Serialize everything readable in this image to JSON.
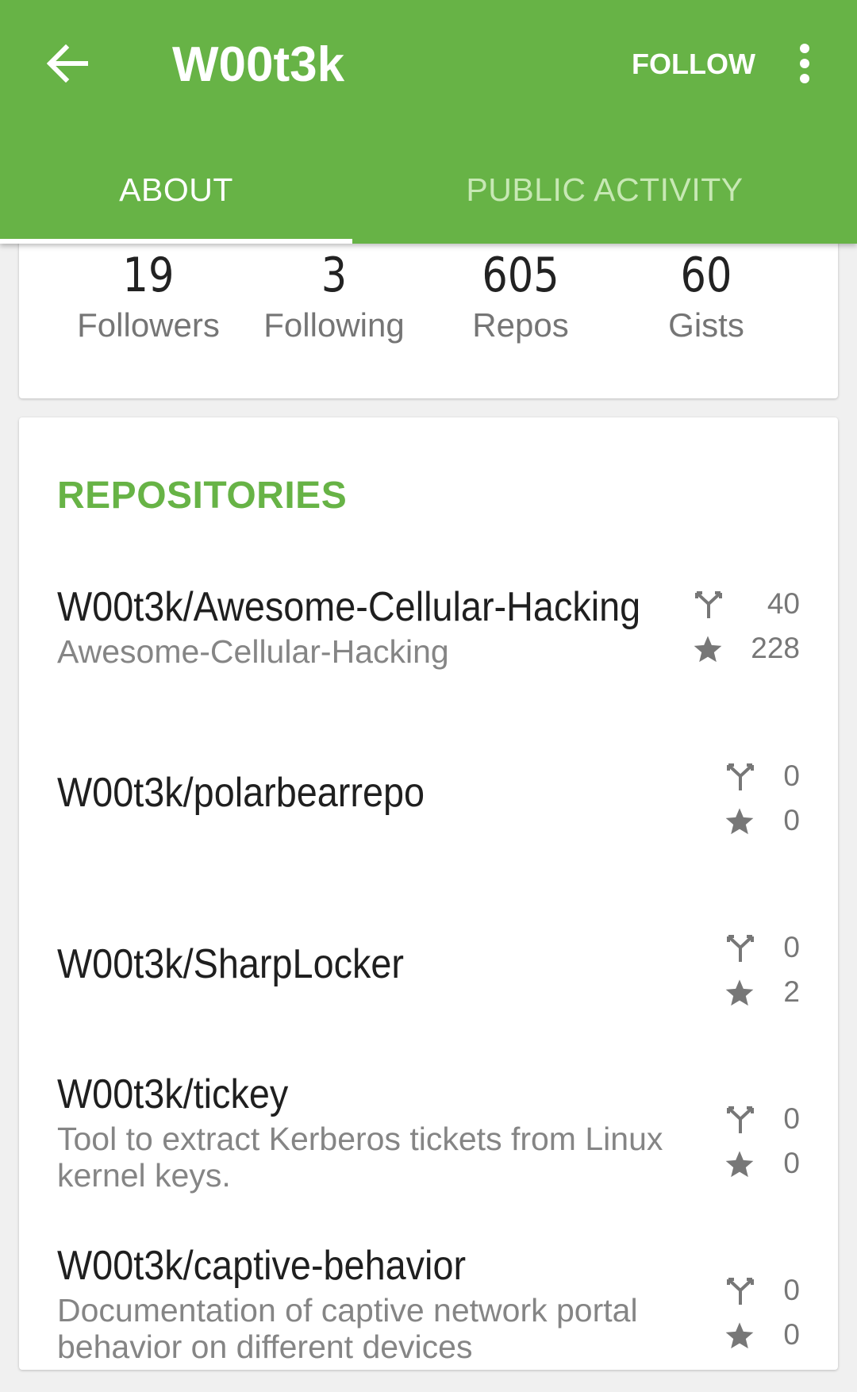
{
  "app_bar": {
    "back_icon": "arrow-left-icon",
    "title": "W00t3k",
    "follow_label": "FOLLOW",
    "more_icon": "more-vertical-icon",
    "background_color": "#67b346"
  },
  "tabs": [
    {
      "label": "ABOUT",
      "selected": true
    },
    {
      "label": "PUBLIC ACTIVITY",
      "selected": false
    }
  ],
  "stats": [
    {
      "value": "19",
      "label": "Followers"
    },
    {
      "value": "3",
      "label": "Following"
    },
    {
      "value": "605",
      "label": "Repos"
    },
    {
      "value": "60",
      "label": "Gists"
    }
  ],
  "repositories": {
    "title": "REPOSITORIES",
    "accent_color": "#67b346",
    "items": [
      {
        "name": "W00t3k/Awesome-Cellular-Hacking",
        "description": "Awesome-Cellular-Hacking",
        "forks": "40",
        "stars": "228"
      },
      {
        "name": "W00t3k/polarbearrepo",
        "description": "",
        "forks": "0",
        "stars": "0"
      },
      {
        "name": "W00t3k/SharpLocker",
        "description": "",
        "forks": "0",
        "stars": "2"
      },
      {
        "name": "W00t3k/tickey",
        "description": "Tool to extract Kerberos tickets from Linux kernel keys.",
        "forks": "0",
        "stars": "0"
      },
      {
        "name": "W00t3k/captive-behavior",
        "description": "Documentation of captive network portal behavior on different devices",
        "forks": "0",
        "stars": "0"
      }
    ]
  }
}
